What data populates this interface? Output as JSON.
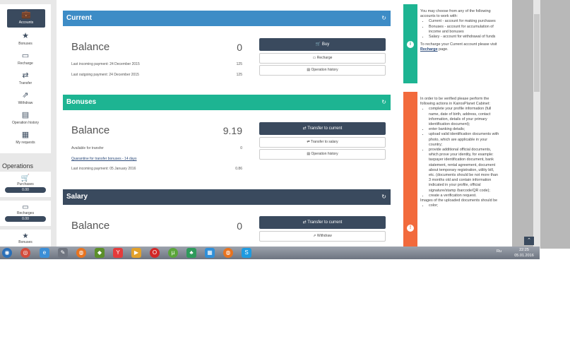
{
  "sidebar": {
    "items": [
      {
        "label": "Accounts",
        "icon": "briefcase-icon",
        "glyph": "💼"
      },
      {
        "label": "Bonuses",
        "icon": "star-icon",
        "glyph": "★"
      },
      {
        "label": "Recharge",
        "icon": "card-icon",
        "glyph": "▭"
      },
      {
        "label": "Transfer",
        "icon": "transfer-icon",
        "glyph": "⇄"
      },
      {
        "label": "Withdraw",
        "icon": "withdraw-icon",
        "glyph": "⇗"
      },
      {
        "label": "Operation history",
        "icon": "document-icon",
        "glyph": "▤"
      },
      {
        "label": "My requests",
        "icon": "list-icon",
        "glyph": "▦"
      }
    ],
    "operations_title": "Operations",
    "operations": [
      {
        "label": "Purchases",
        "value": "0.00",
        "glyph": "🛒"
      },
      {
        "label": "Recharges",
        "value": "0.00",
        "glyph": "▭"
      },
      {
        "label": "Bonuses",
        "value": "",
        "glyph": "★"
      }
    ]
  },
  "current": {
    "title": "Current",
    "balance_label": "Balance",
    "balance_value": "0",
    "rows": [
      {
        "label": "Last incoming payment: 24 December 2015",
        "value": "125"
      },
      {
        "label": "Last outgoing payment: 24 December 2015",
        "value": "125"
      }
    ],
    "buttons": {
      "buy": "Buy",
      "recharge": "Recharge",
      "history": "Operation history"
    },
    "color": "#3d8cc6"
  },
  "bonuses": {
    "title": "Bonuses",
    "balance_label": "Balance",
    "balance_value": "9.19",
    "available_label": "Available for transfer",
    "available_value": "0",
    "quarantine_link": "Quarantine for transfer bonuses - 14 days",
    "last_incoming_label": "Last incoming payment: 05 January 2016",
    "last_incoming_value": "0.86",
    "buttons": {
      "transfer_current": "Transfer to current",
      "transfer_salary": "Transfer to salary",
      "history": "Operation history"
    },
    "color": "#1db492"
  },
  "salary": {
    "title": "Salary",
    "balance_label": "Balance",
    "balance_value": "0",
    "buttons": {
      "transfer_current": "Transfer to current",
      "withdraw": "Withdraw"
    },
    "color": "#3a4a5e"
  },
  "info_accounts": {
    "intro": "You may choose from any of the following accounts to work with:",
    "items": [
      "Current - account for making purchases",
      "Bonuses - account for accumulation of income and bonuses",
      "Salary - account for withdrawal of funds"
    ],
    "footer_pre": "To recharge your Current account please visit",
    "footer_link": "Recharge",
    "footer_post": "page.",
    "color": "#1db492"
  },
  "info_verify": {
    "intro": "In order to be verified please perform the following actions in KairosPlanet Cabinet:",
    "items": [
      "complete your profile information (full name, date of birth, address, contact information, details of your primary identification document);",
      "enter banking details;",
      "upload valid identification documents with photo, which are applicable in your country;",
      "provide additional official documents, which prove your identity, for example: taxpayer identification document, bank statement, rental agreement, document about temporary registration, utility bill, etc. (documents should be not more than 3 months old and contain information indicated in your profile, official signature/stamp /barcode/QR code);",
      "create a verification request."
    ],
    "after": "Images of the uploaded documents should be",
    "sub_items": [
      "color;"
    ],
    "color": "#f26a3c"
  },
  "taskbar": {
    "lang": "Ru",
    "time": "22:25",
    "date": "05.01.2016"
  }
}
